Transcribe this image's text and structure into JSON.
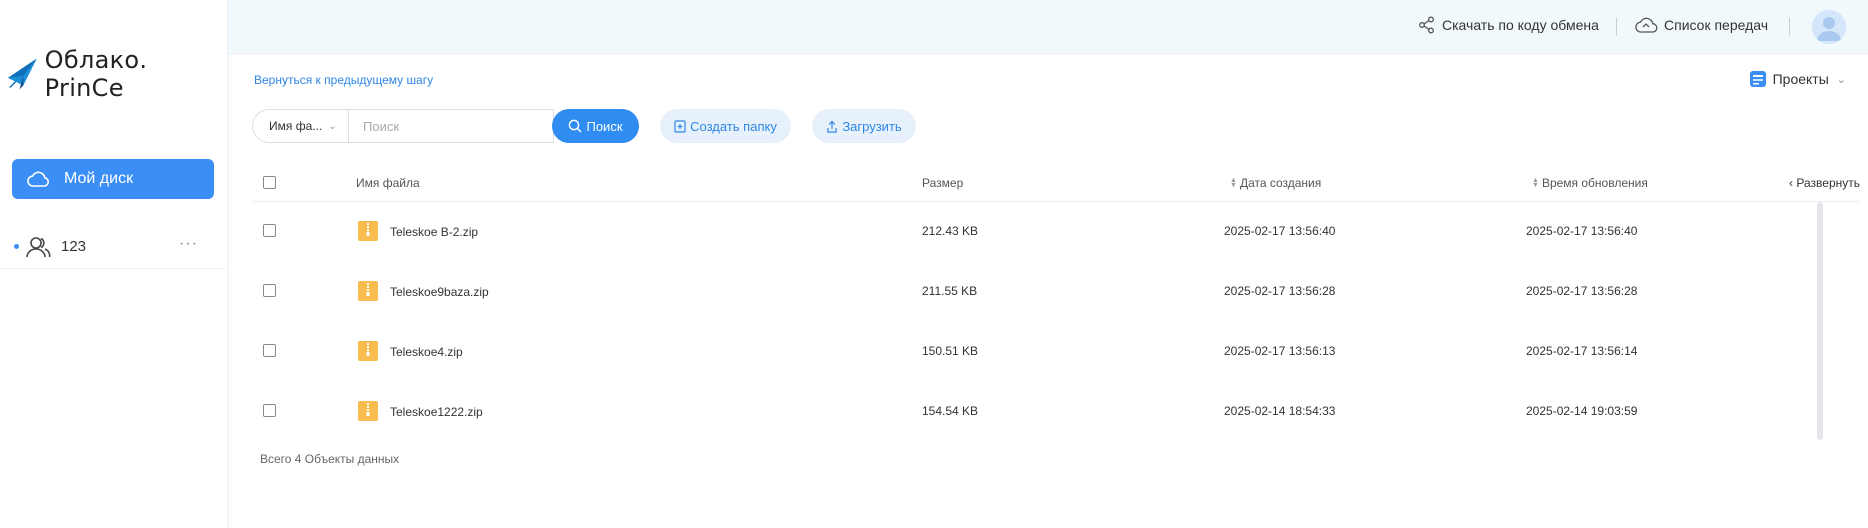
{
  "app": {
    "logo_text": "Облако. PrinCe"
  },
  "sidebar": {
    "my_disk_label": "Мой диск",
    "team": {
      "label": "123",
      "more": "···"
    }
  },
  "topbar": {
    "download_by_code": "Скачать по коду обмена",
    "transfer_list": "Список передач"
  },
  "main": {
    "back_link": "Вернуться к предыдущему шагу",
    "projects_label": "Проекты",
    "search": {
      "field_select": "Имя фа...",
      "placeholder": "Поиск",
      "button": "Поиск"
    },
    "create_folder": "Создать папку",
    "upload": "Загрузить",
    "table": {
      "headers": {
        "name": "Имя файла",
        "size": "Размер",
        "created": "Дата создания",
        "updated": "Время обновления",
        "expand": "Развернуть"
      },
      "rows": [
        {
          "name": "Teleskoe B-2.zip",
          "size": "212.43 KB",
          "created": "2025-02-17 13:56:40",
          "updated": "2025-02-17 13:56:40"
        },
        {
          "name": "Teleskoe9baza.zip",
          "size": "211.55 KB",
          "created": "2025-02-17 13:56:28",
          "updated": "2025-02-17 13:56:28"
        },
        {
          "name": "Teleskoe4.zip",
          "size": "150.51 KB",
          "created": "2025-02-17 13:56:13",
          "updated": "2025-02-17 13:56:14"
        },
        {
          "name": "Teleskoe1222.zip",
          "size": "154.54 KB",
          "created": "2025-02-14 18:54:33",
          "updated": "2025-02-14 19:03:59"
        }
      ]
    },
    "footer": "Всего 4 Объекты данных"
  },
  "colors": {
    "accent": "#2f8cf0",
    "topbar_bg": "#f1f9fc",
    "zip_icon": "#f9bd4f"
  }
}
